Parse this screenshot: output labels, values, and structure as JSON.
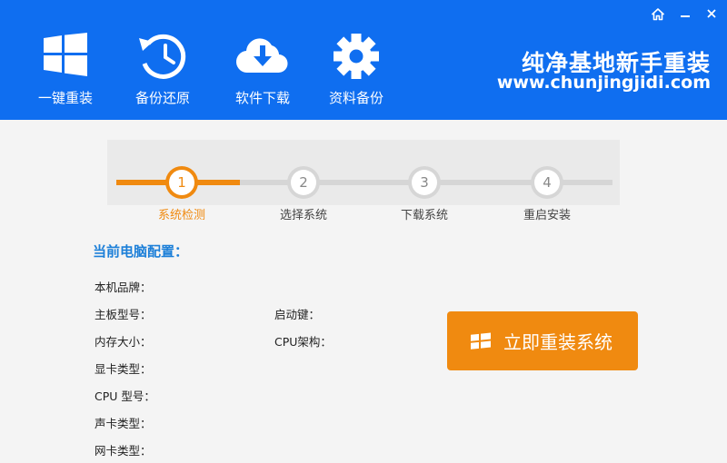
{
  "header": {
    "nav": [
      {
        "label": "一键重装",
        "icon": "windows-logo-icon"
      },
      {
        "label": "备份还原",
        "icon": "backup-restore-icon"
      },
      {
        "label": "软件下载",
        "icon": "cloud-download-icon"
      },
      {
        "label": "资料备份",
        "icon": "gear-icon"
      }
    ],
    "brand_title": "纯净基地新手重装",
    "brand_url": "www.chunjingjidi.com",
    "window_controls": [
      "home-icon",
      "minimize-icon",
      "close-icon"
    ]
  },
  "steps": [
    {
      "number": "1",
      "label": "系统检测",
      "active": true
    },
    {
      "number": "2",
      "label": "选择系统",
      "active": false
    },
    {
      "number": "3",
      "label": "下载系统",
      "active": false
    },
    {
      "number": "4",
      "label": "重启安装",
      "active": false
    }
  ],
  "config": {
    "title": "当前电脑配置：",
    "left": [
      "本机品牌：",
      "主板型号：",
      "内存大小：",
      "显卡类型：",
      "CPU 型号：",
      "声卡类型：",
      "网卡类型："
    ],
    "right": [
      "启动键：",
      "CPU架构："
    ]
  },
  "install_button": {
    "label": "立即重装系统",
    "icon": "windows-logo-icon"
  },
  "colors": {
    "header_blue": "#0f6ef0",
    "accent_orange": "#f08a10",
    "title_blue": "#1c7fd8",
    "inactive_gray": "#d6d6d6"
  }
}
